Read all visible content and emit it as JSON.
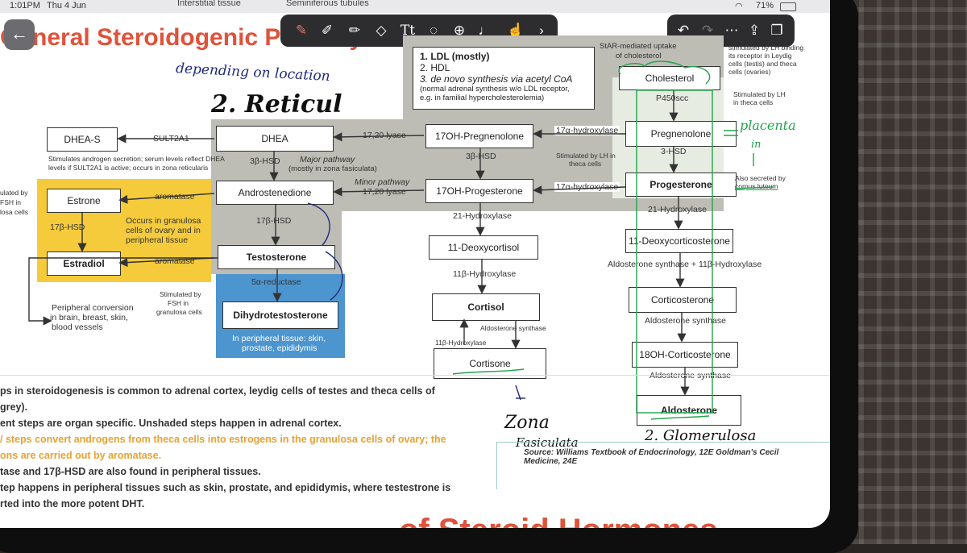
{
  "status": {
    "time": "1:01PM",
    "date": "Thu 4 Jun",
    "battery": "71%"
  },
  "tabs": [
    "Interstitial tissue",
    "Seminiferous tubules"
  ],
  "toolbar": {
    "icons": [
      "pen-icon",
      "pencil-icon",
      "highlighter-icon",
      "eraser-icon",
      "text-icon",
      "lasso-icon",
      "add-icon",
      "mic-icon",
      "hand-icon",
      "chevron-right-icon"
    ],
    "right_icons": [
      "undo-icon",
      "redo-icon",
      "more-icon",
      "export-icon",
      "pages-icon"
    ]
  },
  "title": "General Steroidogenic Pathway",
  "bottom_title": "of Steroid Hormones",
  "sources_box": {
    "line1": "1. LDL (mostly)",
    "line2": "2. HDL",
    "line3": "3. de novo synthesis via acetyl CoA",
    "line4": "(normal adrenal synthesis w/o LDL receptor,",
    "line5": "e.g. in familial hypercholesterolemia)"
  },
  "boxes": {
    "cholesterol": "Cholesterol",
    "pregnenolone": "Pregnenolone",
    "progesterone": "Progesterone",
    "oh_preg": "17OH-Pregnenolone",
    "oh_prog": "17OH-Progesterone",
    "dhea": "DHEA",
    "dheas": "DHEA-S",
    "androstenedione": "Androstenedione",
    "testosterone": "Testosterone",
    "dht": "Dihydrotestosterone",
    "estrone": "Estrone",
    "estradiol": "Estradiol",
    "deoxycortisol": "11-Deoxycortisol",
    "cortisol": "Cortisol",
    "cortisone": "Cortisone",
    "doc": "11-Deoxycorticosterone",
    "corticosterone": "Corticosterone",
    "oh_cort": "18OH-Corticosterone",
    "aldosterone": "Aldosterone"
  },
  "labels": {
    "star": "StAR-mediated uptake",
    "star2": "of cholesterol",
    "lh1": "stimulated by LH binding",
    "lh2": "its receptor in Leydig",
    "lh3": "cells (testis) and theca",
    "lh4": "cells (ovaries)",
    "p450scc": "P450scc",
    "lh_theca1": "Stimulated by LH",
    "lh_theca2": "in theca cells",
    "hsd3_right": "3-HSD",
    "also1": "Also secreted by",
    "also2": "corpus luteum",
    "hydrox17_a": "17α-hydroxylase",
    "hydrox17_b": "17α-hydroxylase",
    "stim_lh1": "Stimulated by LH in",
    "stim_lh2": "theca cells",
    "lyase1": "17,20 lyase",
    "lyase2": "17,20 lyase",
    "hsd3_mid": "3β-HSD",
    "hsd3_left": "3β-HSD",
    "major1": "Major pathway",
    "major2": "(mostly in zona fasiculata)",
    "minor1": "Minor pathway",
    "sult": "SULT2A1",
    "dheas1": "Stimulates androgen secretion; serum levels reflect DHEA",
    "dheas2": "levels if SULT2A1 is active; occurs in zona reticularis",
    "aromatase1": "aromatase",
    "aromatase2": "aromatase",
    "hsd17_left": "17β-HSD",
    "hsd17_mid": "17β-HSD",
    "granulosa1": "Occurs in granulosa",
    "granulosa2": "cells of ovary and in",
    "granulosa3": "peripheral tissue",
    "fsh_left1": "ulated by",
    "fsh_left2": "FSH in",
    "fsh_left3": "losa cells",
    "fsh1": "Stimulated by",
    "fsh2": "FSH in",
    "fsh3": "granulosa cells",
    "periph1": "Peripheral conversion",
    "periph2": "in brain, breast, skin,",
    "periph3": "blood vessels",
    "reductase": "5α-reductase",
    "dht_note1": "In peripheral tissue: skin,",
    "dht_note2": "prostate, epididymis",
    "hydrox21_a": "21-Hydroxylase",
    "hydrox21_b": "21-Hydroxylase",
    "hydrox11_a": "11β-Hydroxylase",
    "hydrox11_b": "11β-Hydroxylase",
    "aldo_synth_a": "Aldosterone synthase",
    "aldo_synth_b": "Aldosterone synthase + 11β-Hydroxylase",
    "aldo_synth_c": "Aldosterone synthase",
    "aldo_synth_d": "Aldosterone synthase"
  },
  "handwriting": {
    "depending": "depending on location",
    "reticul": "2. Reticul",
    "placenta": "placenta",
    "in": "in",
    "zona": "Zona",
    "fasciculata": "Fasiculata",
    "glomerulosa": "2. Glomerulosa"
  },
  "notes": [
    "ps in steroidogenesis is common to adrenal cortex, leydig cells of testes and theca cells of",
    "grey).",
    "ent steps are organ specific. Unshaded steps happen in adrenal cortex.",
    "/ steps convert androgens from theca cells into estrogens in the granulosa cells of ovary; the",
    "ons are carried out by aromatase.",
    "tase and 17β-HSD are also found in peripheral tissues.",
    "tep happens in peripheral tissues such as skin, prostate, and epididymis, where testestrone is",
    "rted into the more potent DHT."
  ],
  "source": "Source: Williams Textbook of Endocrinology, 12E Goldman’s Cecil Medicine, 24E",
  "colors": {
    "title": "#e0523a",
    "grey_region": "#bdbdb6",
    "yellow_region": "#f5cb3c",
    "blue_region": "#4d95cf",
    "handwriting_blue": "#1f2a7a",
    "handwriting_green": "#21a34a"
  }
}
